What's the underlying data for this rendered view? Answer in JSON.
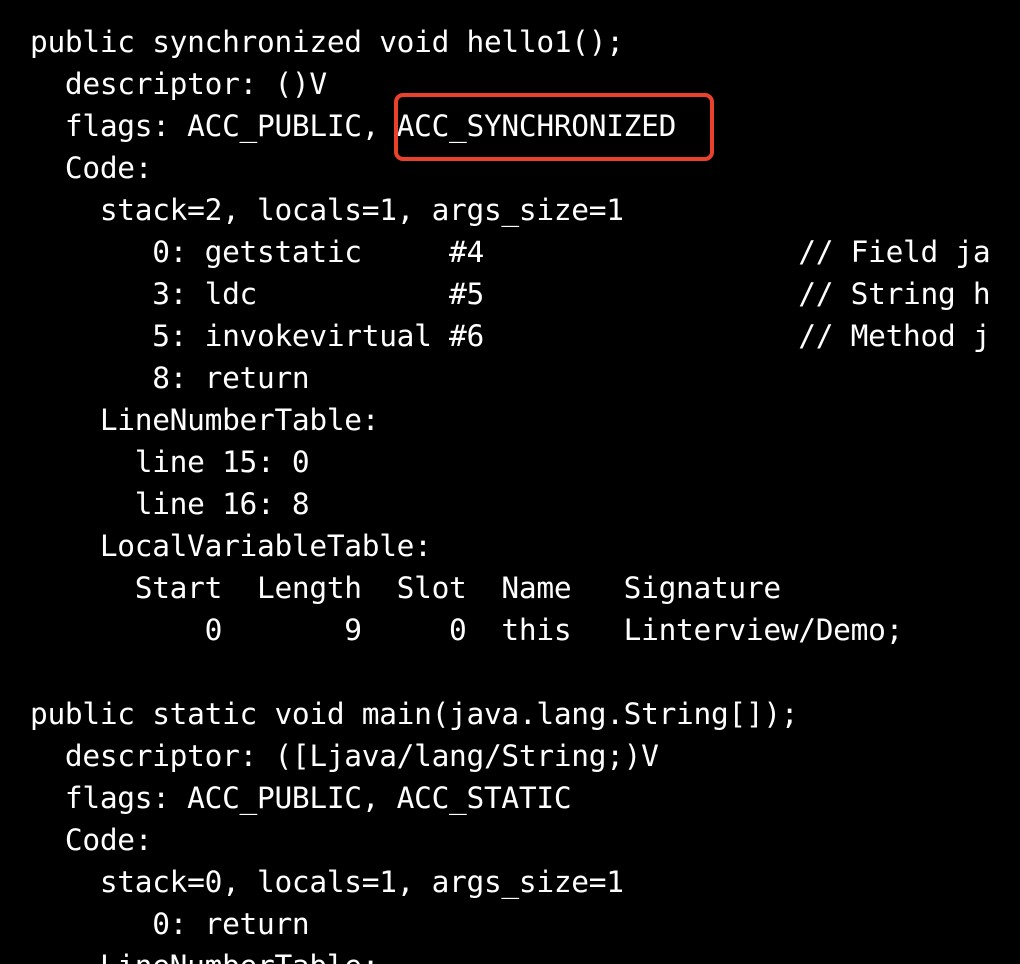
{
  "lines": {
    "l01": "public synchronized void hello1();",
    "l02": "  descriptor: ()V",
    "l03_pre": "  flags: ACC_PUBLIC, ",
    "l03_hl": "ACC_SYNCHRONIZED",
    "l04": "  Code:",
    "l05": "    stack=2, locals=1, args_size=1",
    "l06": "       0: getstatic     #4                  // Field ja",
    "l07": "       3: ldc           #5                  // String h",
    "l08": "       5: invokevirtual #6                  // Method j",
    "l09": "       8: return",
    "l10": "    LineNumberTable:",
    "l11": "      line 15: 0",
    "l12": "      line 16: 8",
    "l13": "    LocalVariableTable:",
    "l14": "      Start  Length  Slot  Name   Signature",
    "l15": "          0       9     0  this   Linterview/Demo;",
    "l16": "",
    "l17": "public static void main(java.lang.String[]);",
    "l18": "  descriptor: ([Ljava/lang/String;)V",
    "l19": "  flags: ACC_PUBLIC, ACC_STATIC",
    "l20": "  Code:",
    "l21": "    stack=0, locals=1, args_size=1",
    "l22": "       0: return",
    "l23": "    LineNumberTable:"
  },
  "colors": {
    "background": "#000000",
    "text": "#ffffff",
    "highlight_border": "#e8412c"
  }
}
